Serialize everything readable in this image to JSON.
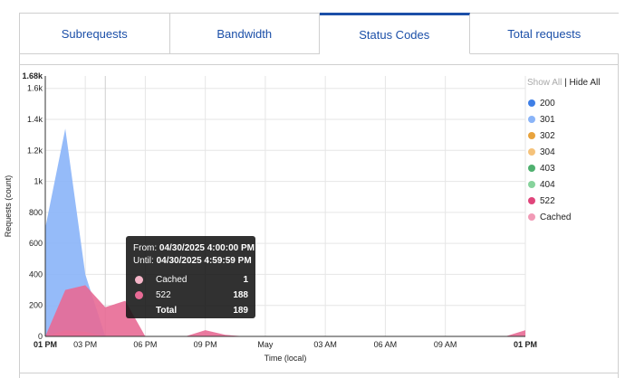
{
  "tabs": [
    {
      "label": "Subrequests",
      "active": false
    },
    {
      "label": "Bandwidth",
      "active": false
    },
    {
      "label": "Status Codes",
      "active": true
    },
    {
      "label": "Total requests",
      "active": false
    }
  ],
  "legend": {
    "show_all": "Show All",
    "separator": "|",
    "hide_all": "Hide All",
    "items": [
      {
        "label": "200",
        "color": "#3f7fe6"
      },
      {
        "label": "301",
        "color": "#8ab4f8"
      },
      {
        "label": "302",
        "color": "#e8a33d"
      },
      {
        "label": "304",
        "color": "#f5c27a"
      },
      {
        "label": "403",
        "color": "#4fb06f"
      },
      {
        "label": "404",
        "color": "#86d39c"
      },
      {
        "label": "522",
        "color": "#e0457b"
      },
      {
        "label": "Cached",
        "color": "#f19ab6"
      }
    ]
  },
  "tooltip": {
    "from_label": "From:",
    "from_value": "04/30/2025 4:00:00 PM",
    "until_label": "Until:",
    "until_value": "04/30/2025 4:59:59 PM",
    "rows": [
      {
        "name": "Cached",
        "value": "1",
        "color": "#f5b5c8"
      },
      {
        "name": "522",
        "value": "188",
        "color": "#e86a95"
      }
    ],
    "total_label": "Total",
    "total_value": "189"
  },
  "chart_data": {
    "type": "area",
    "ylabel": "Requests (count)",
    "xlabel": "Time (local)",
    "ymax_label": "1.68k",
    "ylim": [
      0,
      1680
    ],
    "y_ticks": [
      {
        "value": 0,
        "label": "0"
      },
      {
        "value": 200,
        "label": "200"
      },
      {
        "value": 400,
        "label": "400"
      },
      {
        "value": 600,
        "label": "600"
      },
      {
        "value": 800,
        "label": "800"
      },
      {
        "value": 1000,
        "label": "1k"
      },
      {
        "value": 1200,
        "label": "1.2k"
      },
      {
        "value": 1400,
        "label": "1.4k"
      },
      {
        "value": 1600,
        "label": "1.6k"
      }
    ],
    "x_range_hours": [
      0,
      24
    ],
    "x_ticks": [
      {
        "hour": 0,
        "label": "01 PM",
        "bold": true
      },
      {
        "hour": 2,
        "label": "03 PM",
        "bold": false
      },
      {
        "hour": 5,
        "label": "06 PM",
        "bold": false
      },
      {
        "hour": 8,
        "label": "09 PM",
        "bold": false
      },
      {
        "hour": 11,
        "label": "May",
        "bold": false
      },
      {
        "hour": 14,
        "label": "03 AM",
        "bold": false
      },
      {
        "hour": 17,
        "label": "06 AM",
        "bold": false
      },
      {
        "hour": 20,
        "label": "09 AM",
        "bold": false
      },
      {
        "hour": 24,
        "label": "01 PM",
        "bold": true
      }
    ],
    "hover_hour": 3,
    "series": [
      {
        "name": "301",
        "color": "#8ab4f8",
        "points": [
          [
            0,
            700
          ],
          [
            1,
            1340
          ],
          [
            2,
            400
          ],
          [
            3,
            0
          ],
          [
            4,
            0
          ],
          [
            5,
            0
          ],
          [
            24,
            0
          ]
        ]
      },
      {
        "name": "Cached",
        "color": "#f19ab6",
        "points": [
          [
            0,
            0
          ],
          [
            1,
            40
          ],
          [
            2,
            30
          ],
          [
            3,
            1
          ],
          [
            4,
            0
          ],
          [
            24,
            0
          ]
        ]
      },
      {
        "name": "522",
        "color": "#e86a95",
        "points": [
          [
            0,
            0
          ],
          [
            1,
            300
          ],
          [
            2,
            330
          ],
          [
            3,
            188
          ],
          [
            4,
            230
          ],
          [
            5,
            0
          ],
          [
            6,
            0
          ],
          [
            7,
            0
          ],
          [
            8,
            40
          ],
          [
            9,
            10
          ],
          [
            10,
            0
          ],
          [
            23,
            0
          ],
          [
            24,
            40
          ]
        ]
      }
    ]
  }
}
